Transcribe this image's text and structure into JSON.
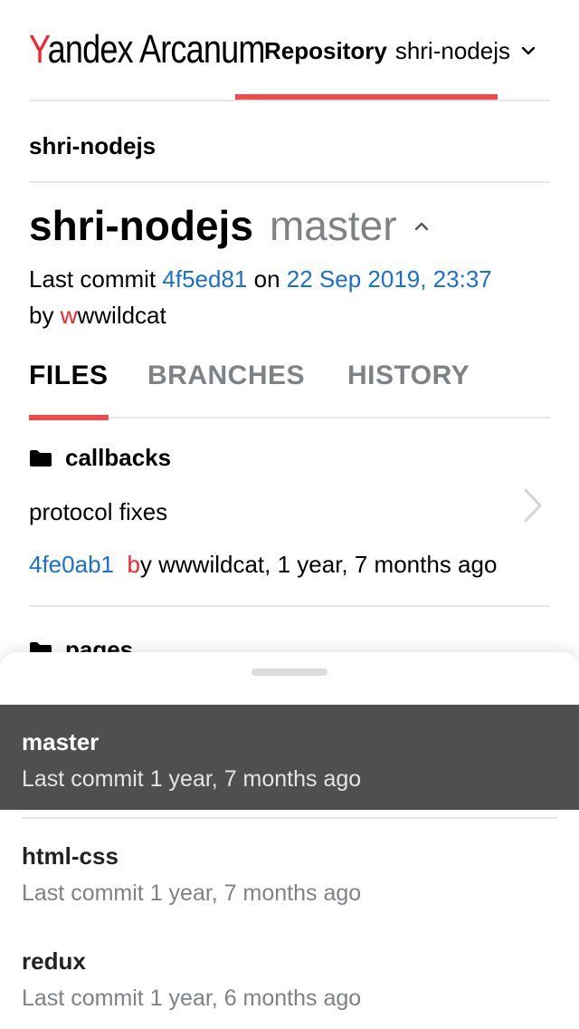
{
  "header": {
    "logo_y": "Y",
    "logo_rest": "andex Arcanum",
    "repo_label": "Repository",
    "repo_name": "shri-nodejs"
  },
  "breadcrumb": "shri-nodejs",
  "title": {
    "repo": "shri-nodejs",
    "branch": "master"
  },
  "commit": {
    "prefix": "Last commit",
    "hash": "4f5ed81",
    "on": "on",
    "date": "22 Sep 2019, 23:37",
    "by": "by",
    "author_first": "w",
    "author_rest": "wwildcat"
  },
  "tabs": [
    {
      "label": "FILES",
      "active": true
    },
    {
      "label": "BRANCHES",
      "active": false
    },
    {
      "label": "HISTORY",
      "active": false
    }
  ],
  "files": [
    {
      "name": "callbacks",
      "message": "protocol fixes",
      "hash": "4fe0ab1",
      "by_first": "b",
      "by_rest": "y wwwildcat, 1 year, 7 months ago"
    },
    {
      "name": "pages"
    }
  ],
  "branches": [
    {
      "name": "master",
      "commit": "Last commit 1 year, 7 months ago",
      "selected": true
    },
    {
      "name": "html-css",
      "commit": "Last commit 1 year, 7 months ago",
      "selected": false
    },
    {
      "name": "redux",
      "commit": "Last commit 1 year, 6 months ago",
      "selected": false
    }
  ],
  "colors": {
    "accent_red": "#f04b4b",
    "link_blue": "#1a6fd3",
    "muted_gray": "#7f8285",
    "selected_bg": "#4f4f4f"
  }
}
